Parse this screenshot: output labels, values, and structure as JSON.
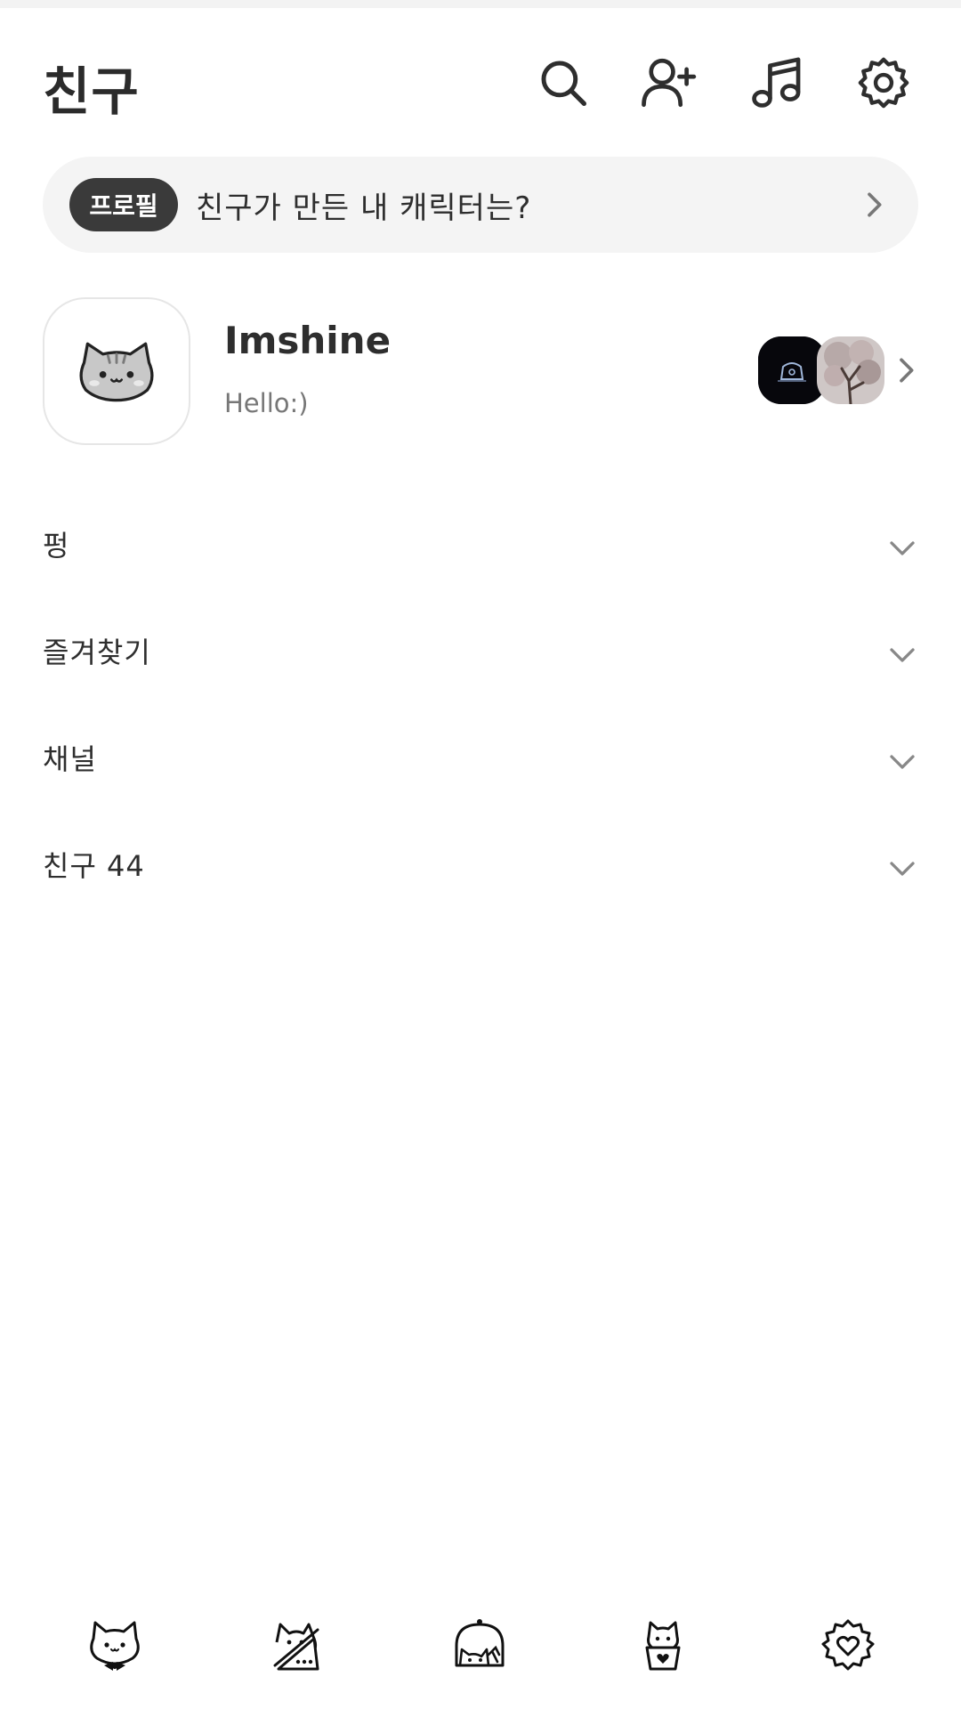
{
  "header": {
    "title": "친구",
    "icons": [
      "search-icon",
      "add-friend-icon",
      "music-icon",
      "settings-icon"
    ]
  },
  "banner": {
    "badge": "프로필",
    "text": "친구가 만든 내 캐릭터는?"
  },
  "profile": {
    "name": "Imshine",
    "status": "Hello:)"
  },
  "sections": [
    {
      "label": "펑"
    },
    {
      "label": "즐겨찾기"
    },
    {
      "label": "채널"
    },
    {
      "label": "친구 44"
    }
  ],
  "bottom_nav": {
    "items": [
      "cat-bowtie-icon",
      "cat-chat-icon",
      "cat-dome-icon",
      "cat-basket-icon",
      "cat-flower-heart-icon"
    ]
  },
  "colors": {
    "text": "#2e2e2e",
    "banner_bg": "#f4f4f4",
    "badge_bg": "#3a3a3a",
    "chevron": "#888888"
  }
}
